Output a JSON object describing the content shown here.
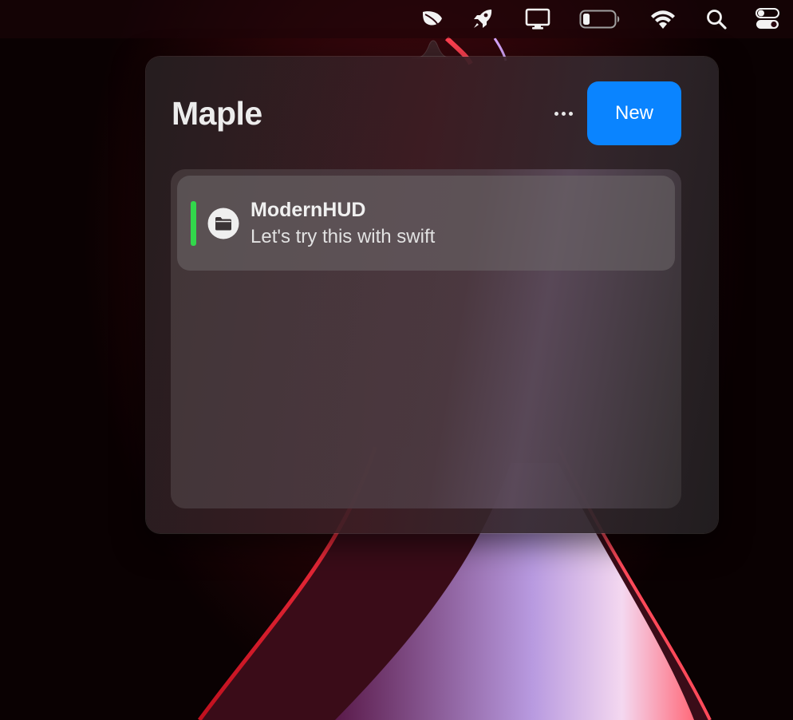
{
  "menubar": {
    "items": [
      {
        "icon": "leaf-icon"
      },
      {
        "icon": "rocket-icon"
      },
      {
        "icon": "display-icon"
      },
      {
        "icon": "battery-icon"
      },
      {
        "icon": "wifi-icon"
      },
      {
        "icon": "search-icon"
      },
      {
        "icon": "control-center-icon"
      }
    ]
  },
  "popover": {
    "title": "Maple",
    "more_icon": "ellipsis-icon",
    "new_label": "New",
    "items": [
      {
        "title": "ModernHUD",
        "subtitle": "Let's try this with swift",
        "icon": "folder-icon",
        "status_color": "#32d74b"
      }
    ]
  },
  "colors": {
    "accent": "#0a84ff",
    "status_green": "#32d74b"
  }
}
